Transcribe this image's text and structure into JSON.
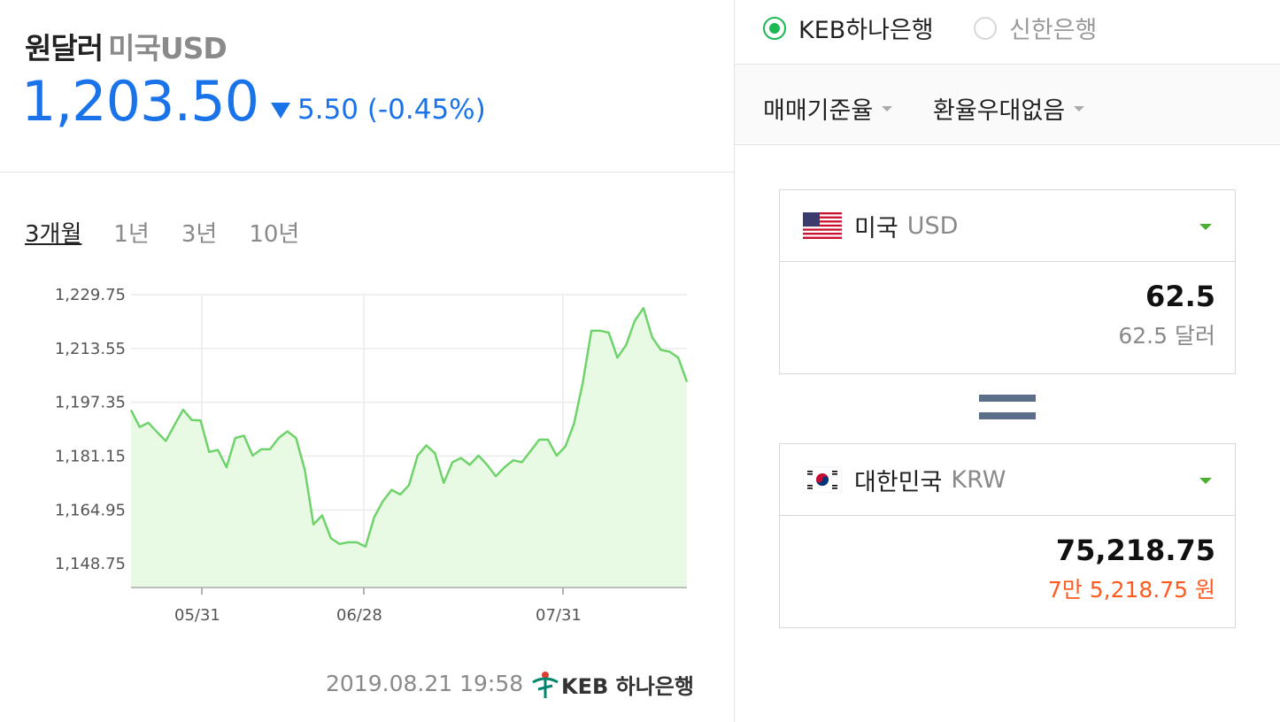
{
  "header": {
    "title": "원달러",
    "subtitle": "미국USD",
    "rate": "1,203.50",
    "change": "5.50 (-0.45%)",
    "direction": "down"
  },
  "periods": {
    "items": [
      "3개월",
      "1년",
      "3년",
      "10년"
    ],
    "active": "3개월"
  },
  "chart_data": {
    "type": "area",
    "yticks": [
      "1,229.75",
      "1,213.55",
      "1,197.35",
      "1,181.15",
      "1,164.95",
      "1,148.75"
    ],
    "ylim": [
      1141.6,
      1229.75
    ],
    "xticks": [
      "05/31",
      "06/28",
      "07/31"
    ],
    "line_color": "#6fd36b",
    "fill_color": "#e8fae3",
    "series": [
      {
        "values": [
          1195.0,
          1189.9,
          1191.2,
          1188.4,
          1185.7,
          1190.5,
          1195.1,
          1192.0,
          1191.9,
          1182.4,
          1183.0,
          1177.8,
          1186.6,
          1187.3,
          1181.3,
          1183.2,
          1183.2,
          1186.6,
          1188.6,
          1186.6,
          1177.0,
          1160.6,
          1163.3,
          1156.5,
          1154.7,
          1155.2,
          1155.2,
          1153.9,
          1162.8,
          1167.6,
          1171.0,
          1169.6,
          1172.4,
          1181.3,
          1184.4,
          1182.0,
          1173.1,
          1179.3,
          1180.6,
          1178.5,
          1181.3,
          1178.5,
          1175.1,
          1177.8,
          1179.9,
          1179.3,
          1182.7,
          1186.1,
          1186.1,
          1181.3,
          1184.0,
          1190.9,
          1203.2,
          1218.9,
          1218.9,
          1218.3,
          1210.8,
          1214.6,
          1221.9,
          1225.7,
          1216.9,
          1213.1,
          1212.6,
          1210.8,
          1203.5
        ]
      }
    ]
  },
  "footer": {
    "timestamp": "2019.08.21 19:58",
    "bank_logo": "KEB 하나은행"
  },
  "banks": {
    "option1": "KEB하나은행",
    "option2": "신한은행",
    "selected": "KEB하나은행"
  },
  "selects": {
    "rate_type": "매매기준율",
    "preference": "환율우대없음"
  },
  "from": {
    "country": "미국",
    "code": "USD",
    "amount": "62.5",
    "amount_text": "62.5 달러"
  },
  "to": {
    "country": "대한민국",
    "code": "KRW",
    "amount": "75,218.75",
    "amount_text": "7만 5,218.75 원",
    "amount_text_color": "#ff5a1f"
  }
}
